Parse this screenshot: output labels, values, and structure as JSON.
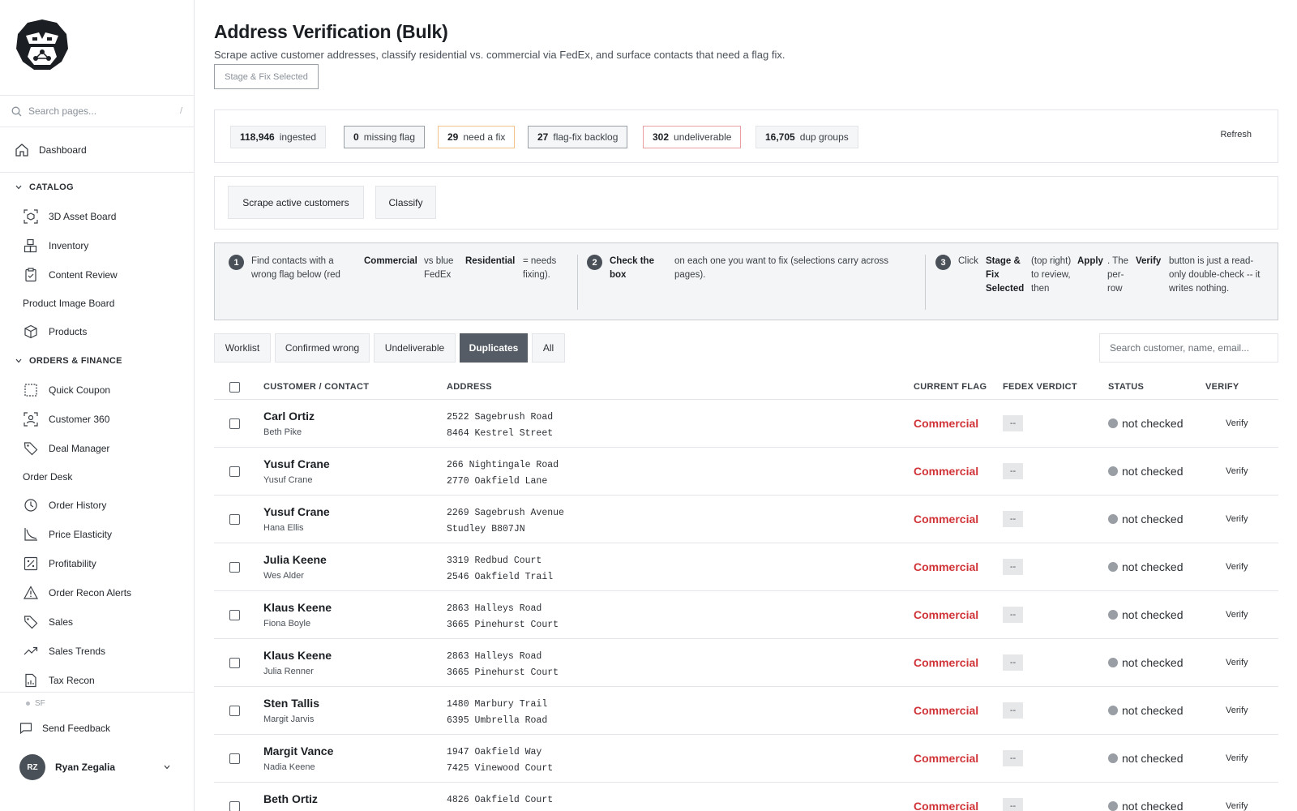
{
  "sidebar": {
    "search_placeholder": "Search pages...",
    "search_shortcut": "/",
    "dashboard": "Dashboard",
    "sections": [
      {
        "title": "CATALOG",
        "items": [
          "3D Asset Board",
          "Inventory",
          "Content Review"
        ]
      },
      {
        "title": "ORDERS & FINANCE",
        "items": [
          "Quick Coupon",
          "Customer 360",
          "Deal Manager"
        ]
      }
    ],
    "catalog_plain": "Product Image Board",
    "catalog_after": [
      "Products"
    ],
    "orders_plain": "Order Desk",
    "orders_after": [
      "Order History",
      "Price Elasticity",
      "Profitability",
      "Order Recon Alerts",
      "Sales",
      "Sales Trends",
      "Tax Recon"
    ],
    "env": "SF",
    "feedback": "Send Feedback",
    "user": {
      "initials": "RZ",
      "name": "Ryan Zegalia"
    }
  },
  "page": {
    "title": "Address Verification (Bulk)",
    "subtitle": "Scrape active customer addresses, classify residential vs. commercial via FedEx, and surface contacts that need a flag fix.",
    "stage_button": "Stage & Fix Selected"
  },
  "stats": [
    {
      "value": "118,946",
      "label": "ingested",
      "border": "#e3e5e8"
    },
    {
      "value": "0",
      "label": "missing flag",
      "border": "#9aa0a6"
    },
    {
      "value": "29",
      "label": "need a fix",
      "border": "#f2c48a"
    },
    {
      "value": "27",
      "label": "flag-fix backlog",
      "border": "#9aa0a6"
    },
    {
      "value": "302",
      "label": "undeliverable",
      "border": "#e8a0a3"
    },
    {
      "value": "16,705",
      "label": "dup groups",
      "border": "#e3e5e8"
    }
  ],
  "refresh_label": "Refresh",
  "actions": {
    "scrape": "Scrape active customers",
    "classify": "Classify"
  },
  "steps": {
    "s1": {
      "num": "1",
      "a": "Find contacts with a wrong flag below (red",
      "b": "Commercial",
      "c": "vs blue FedEx",
      "d": "Residential",
      "e": "= needs fixing)."
    },
    "s2": {
      "num": "2",
      "a": "Check the box",
      "b": "on each one you want to fix (selections carry across pages)."
    },
    "s3": {
      "num": "3",
      "a": "Click",
      "b": "Stage & Fix Selected",
      "c": "(top right) to review, then",
      "d": "Apply",
      "e": ". The per-row",
      "f": "Verify",
      "g": "button is just a read-only double-check -- it writes nothing."
    }
  },
  "tabs": [
    "Worklist",
    "Confirmed wrong",
    "Undeliverable",
    "Duplicates",
    "All"
  ],
  "active_tab": "Duplicates",
  "table_search_placeholder": "Search customer, name, email...",
  "columns": {
    "customer": "CUSTOMER / CONTACT",
    "address": "ADDRESS",
    "flag": "CURRENT FLAG",
    "verdict": "FEDEX VERDICT",
    "status": "STATUS",
    "verify": "VERIFY"
  },
  "rows": [
    {
      "name": "Carl Ortiz",
      "contact": "Beth Pike",
      "addr1": "2522 Sagebrush Road",
      "addr2": "8464 Kestrel Street",
      "flag": "Commercial",
      "verdict": "--",
      "status": "not checked",
      "verify": "Verify"
    },
    {
      "name": "Yusuf Crane",
      "contact": "Yusuf Crane",
      "addr1": "266 Nightingale Road",
      "addr2": "2770 Oakfield Lane",
      "flag": "Commercial",
      "verdict": "--",
      "status": "not checked",
      "verify": "Verify"
    },
    {
      "name": "Yusuf Crane",
      "contact": "Hana Ellis",
      "addr1": "2269 Sagebrush Avenue",
      "addr2": "Studley B807JN",
      "flag": "Commercial",
      "verdict": "--",
      "status": "not checked",
      "verify": "Verify"
    },
    {
      "name": "Julia Keene",
      "contact": "Wes Alder",
      "addr1": "3319 Redbud Court",
      "addr2": "2546 Oakfield Trail",
      "flag": "Commercial",
      "verdict": "--",
      "status": "not checked",
      "verify": "Verify"
    },
    {
      "name": "Klaus Keene",
      "contact": "Fiona Boyle",
      "addr1": "2863 Halleys Road",
      "addr2": "3665 Pinehurst Court",
      "flag": "Commercial",
      "verdict": "--",
      "status": "not checked",
      "verify": "Verify"
    },
    {
      "name": "Klaus Keene",
      "contact": "Julia Renner",
      "addr1": "2863 Halleys Road",
      "addr2": "3665 Pinehurst Court",
      "flag": "Commercial",
      "verdict": "--",
      "status": "not checked",
      "verify": "Verify"
    },
    {
      "name": "Sten Tallis",
      "contact": "Margit Jarvis",
      "addr1": "1480 Marbury Trail",
      "addr2": "6395 Umbrella Road",
      "flag": "Commercial",
      "verdict": "--",
      "status": "not checked",
      "verify": "Verify"
    },
    {
      "name": "Margit Vance",
      "contact": "Nadia Keene",
      "addr1": "1947 Oakfield Way",
      "addr2": "7425 Vinewood Court",
      "flag": "Commercial",
      "verdict": "--",
      "status": "not checked",
      "verify": "Verify"
    },
    {
      "name": "Beth Ortiz",
      "contact": "",
      "addr1": "4826 Oakfield Court",
      "addr2": "",
      "flag": "Commercial",
      "verdict": "--",
      "status": "not checked",
      "verify": "Verify"
    }
  ],
  "colors": {
    "flag_commercial": "#d13438",
    "active_tab": "#555c65"
  }
}
